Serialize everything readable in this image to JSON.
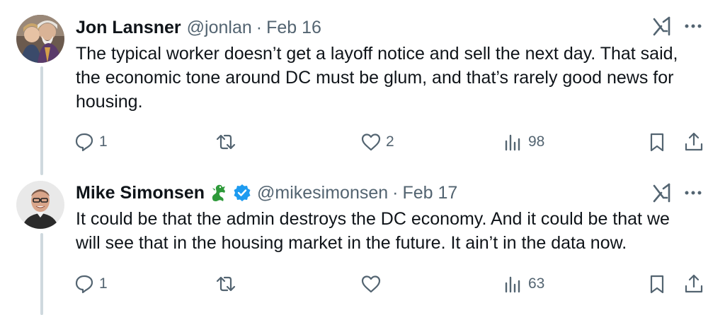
{
  "tweets": [
    {
      "name": "Jon Lansner",
      "handle": "@jonlan",
      "separator": "·",
      "date": "Feb 16",
      "text": "The typical worker doesn’t get a layoff notice and sell the next day. That said, the economic tone around DC must be glum, and that’s rarely good news for housing.",
      "replies": "1",
      "reposts": "",
      "likes": "2",
      "views": "98",
      "verified": false,
      "avatar_icon": "two-people-photo-icon"
    },
    {
      "name": "Mike Simonsen",
      "handle": "@mikesimonsen",
      "separator": "·",
      "date": "Feb 17",
      "text": "It could be that the admin destroys the DC economy. And it could be that we will see that in the housing market in the future. It ain’t in the data now.",
      "replies": "1",
      "reposts": "",
      "likes": "",
      "views": "63",
      "verified": true,
      "avatar_icon": "man-portrait-photo-icon"
    }
  ],
  "colors": {
    "text": "#0f1419",
    "muted": "#536471",
    "verified": "#1d9bf0",
    "thread_line": "#cfd9de",
    "dragon": "#2e9a3a"
  }
}
